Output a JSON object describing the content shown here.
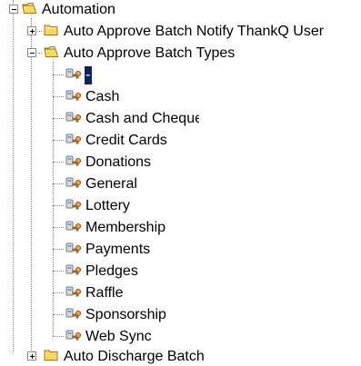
{
  "tree": {
    "root": {
      "label": "Automation",
      "expanded": true,
      "icon": "folder-open-icon"
    },
    "groups": [
      {
        "label": "Auto Approve Batch Notify ThankQ User",
        "expanded": false,
        "icon": "folder-closed-icon"
      },
      {
        "label": "Auto Approve Batch Types",
        "expanded": true,
        "icon": "folder-open-icon"
      }
    ],
    "items": [
      {
        "label": "-",
        "selected": true,
        "icon": "setting-key-icon"
      },
      {
        "label": "Cash",
        "icon": "setting-key-icon"
      },
      {
        "label": "Cash and Cheque",
        "icon": "setting-key-icon"
      },
      {
        "label": "Credit Cards",
        "icon": "setting-key-icon"
      },
      {
        "label": "Donations",
        "icon": "setting-key-icon"
      },
      {
        "label": "General",
        "icon": "setting-key-icon"
      },
      {
        "label": "Lottery",
        "icon": "setting-key-icon"
      },
      {
        "label": "Membership",
        "icon": "setting-key-icon"
      },
      {
        "label": "Payments",
        "icon": "setting-key-icon"
      },
      {
        "label": "Pledges",
        "icon": "setting-key-icon"
      },
      {
        "label": "Raffle",
        "icon": "setting-key-icon"
      },
      {
        "label": "Sponsorship",
        "icon": "setting-key-icon"
      },
      {
        "label": "Web Sync",
        "icon": "setting-key-icon"
      }
    ],
    "partial_next": {
      "label": "Auto Discharge Batch",
      "icon": "folder-closed-icon"
    }
  }
}
